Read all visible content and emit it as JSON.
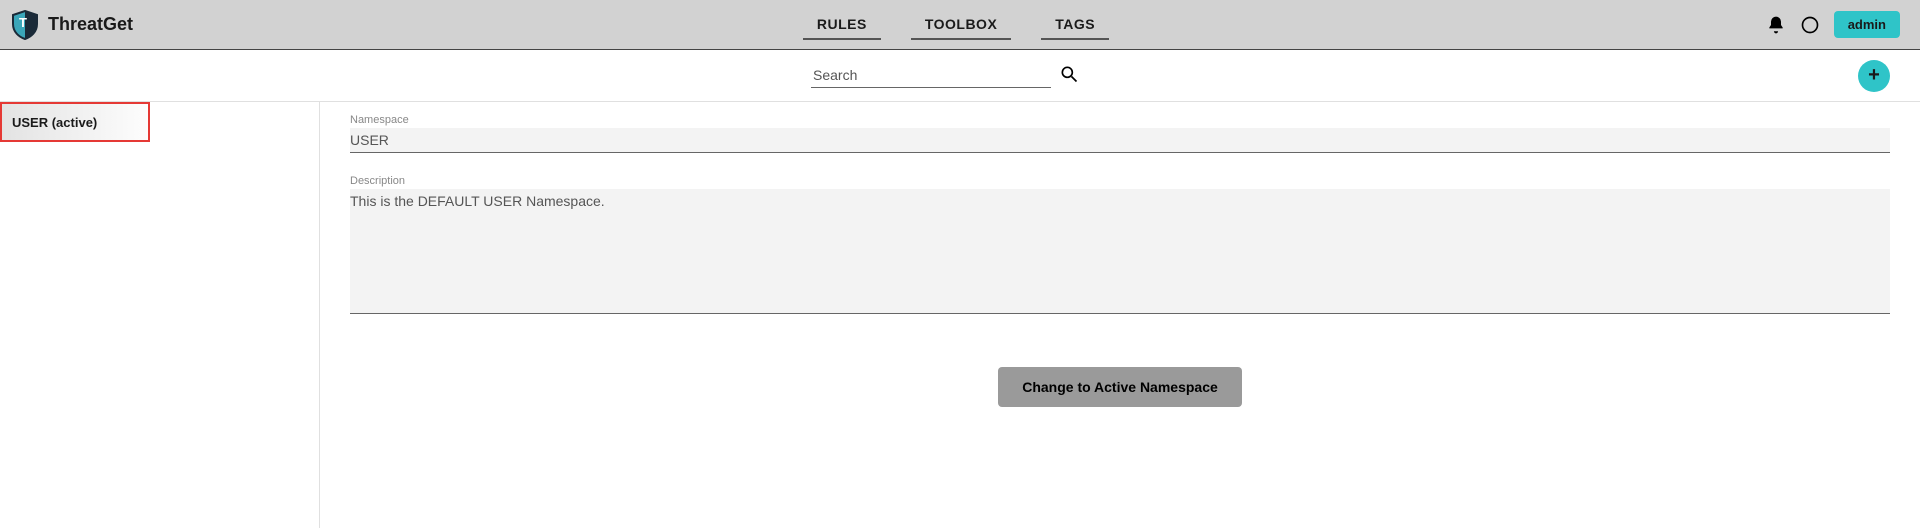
{
  "header": {
    "brand": "ThreatGet",
    "nav": [
      "RULES",
      "TOOLBOX",
      "TAGS"
    ],
    "user_label": "admin"
  },
  "toolbar": {
    "search_placeholder": "Search",
    "add_label": "+"
  },
  "sidebar": {
    "items": [
      {
        "label": "USER (active)"
      }
    ]
  },
  "main": {
    "namespace_label": "Namespace",
    "namespace_value": "USER",
    "description_label": "Description",
    "description_value": "This is the DEFAULT USER Namespace.",
    "change_btn_label": "Change to Active Namespace"
  }
}
